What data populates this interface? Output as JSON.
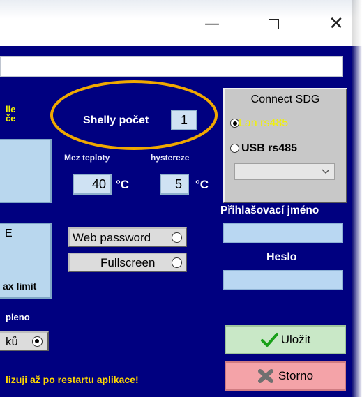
{
  "window": {
    "minimize_glyph": "—",
    "close_glyph": "✕"
  },
  "left": {
    "cut_label_1": "lle",
    "cut_label_2": "če",
    "cut_box_top": "E",
    "cut_box_bottom": "ax limit",
    "cut_label_3": "pleno",
    "cut_radio_label": "ků"
  },
  "shelly": {
    "label": "Shelly počet",
    "value": "1"
  },
  "temps": {
    "mez_label": "Mez teploty",
    "hyst_label": "hystereze",
    "mez_value": "40",
    "hyst_value": "5",
    "unit": "°C"
  },
  "options": {
    "web_password": "Web password",
    "fullscreen": "Fullscreen"
  },
  "sdg": {
    "title": "Connect SDG",
    "lan": "Lan rs485",
    "usb": "USB rs485",
    "dropdown_value": ""
  },
  "login": {
    "user_label": "Přihlašovací jméno",
    "user_value": "",
    "pass_label": "Heslo",
    "pass_value": ""
  },
  "buttons": {
    "save": "Uložit",
    "cancel": "Storno"
  },
  "footer_note": "lizuji až po restartu aplikace!",
  "colors": {
    "background": "#000080",
    "accent_ring": "#f0a800",
    "warning_text": "#ffd700"
  }
}
